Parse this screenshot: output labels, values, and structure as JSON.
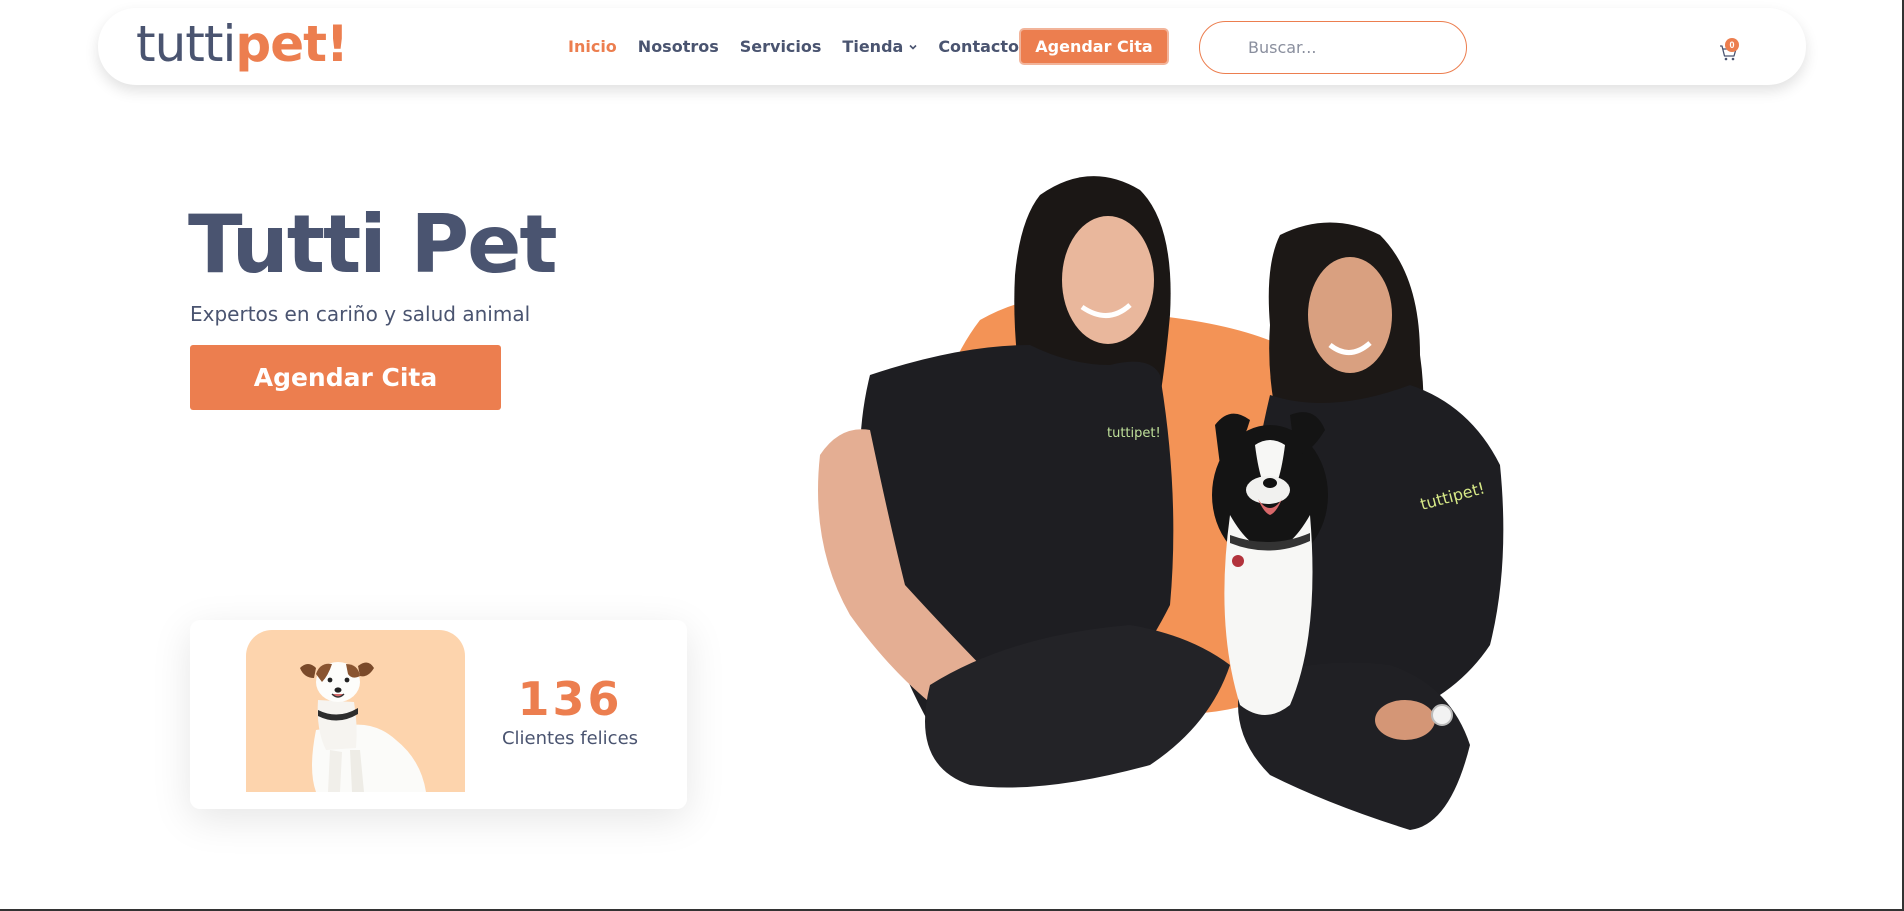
{
  "header": {
    "logo_part1": "tutti",
    "logo_part2": "pet!",
    "nav": [
      {
        "label": "Inicio",
        "active": true
      },
      {
        "label": "Nosotros",
        "active": false
      },
      {
        "label": "Servicios",
        "active": false
      },
      {
        "label": "Tienda",
        "active": false,
        "dropdown": true
      },
      {
        "label": "Contacto",
        "active": false
      }
    ],
    "cta_label": "Agendar Cita",
    "search_placeholder": "Buscar...",
    "cart_count": "0",
    "cart_icon": "cart-icon"
  },
  "hero": {
    "title": "Tutti Pet",
    "subtitle": "Expertos en cariño y salud animal",
    "cta_label": "Agendar Cita",
    "photo_logo_text": "tuttipet!"
  },
  "stat": {
    "number": "136",
    "label": "Clientes felices"
  },
  "colors": {
    "accent": "#ec7e4f",
    "text": "#4a5470",
    "peach": "#fdd4ad",
    "blob": "#f39356"
  }
}
